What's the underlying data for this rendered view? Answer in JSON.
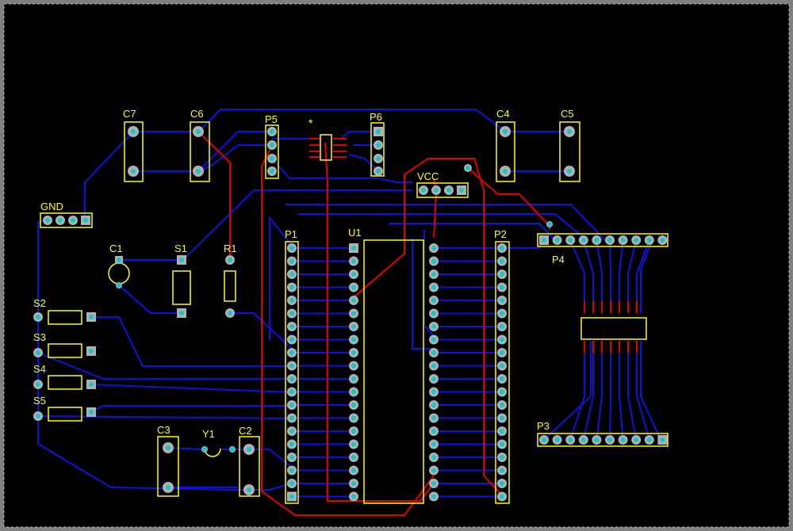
{
  "board": {
    "components": [
      {
        "id": "C7",
        "label": "C7"
      },
      {
        "id": "C6",
        "label": "C6"
      },
      {
        "id": "P5",
        "label": "P5"
      },
      {
        "id": "P6",
        "label": "P6"
      },
      {
        "id": "C4",
        "label": "C4"
      },
      {
        "id": "C5",
        "label": "C5"
      },
      {
        "id": "GND",
        "label": "GND"
      },
      {
        "id": "VCC",
        "label": "VCC"
      },
      {
        "id": "C1",
        "label": "C1"
      },
      {
        "id": "S1",
        "label": "S1"
      },
      {
        "id": "R1",
        "label": "R1"
      },
      {
        "id": "P1",
        "label": "P1"
      },
      {
        "id": "U1",
        "label": "U1"
      },
      {
        "id": "P2",
        "label": "P2"
      },
      {
        "id": "P4",
        "label": "P4"
      },
      {
        "id": "S2",
        "label": "S2"
      },
      {
        "id": "S3",
        "label": "S3"
      },
      {
        "id": "S4",
        "label": "S4"
      },
      {
        "id": "S5",
        "label": "S5"
      },
      {
        "id": "C3",
        "label": "C3"
      },
      {
        "id": "Y1",
        "label": "Y1"
      },
      {
        "id": "C2",
        "label": "C2"
      },
      {
        "id": "P3",
        "label": "P3"
      }
    ]
  },
  "colors": {
    "background": "#000000",
    "frame": "#808080",
    "silkscreen": "#ffff00",
    "top_layer": "#e00000",
    "bottom_layer": "#1010e0",
    "pad": "#b0b0b0",
    "hole": "#10c8c8"
  }
}
